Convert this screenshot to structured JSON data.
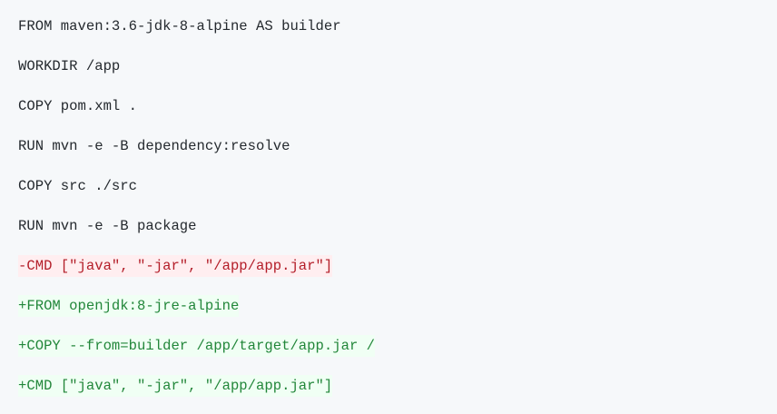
{
  "code": {
    "language": "diff",
    "lines": [
      {
        "type": "context",
        "text": "FROM maven:3.6-jdk-8-alpine AS builder"
      },
      {
        "type": "context",
        "text": "WORKDIR /app"
      },
      {
        "type": "context",
        "text": "COPY pom.xml ."
      },
      {
        "type": "context",
        "text": "RUN mvn -e -B dependency:resolve"
      },
      {
        "type": "context",
        "text": "COPY src ./src"
      },
      {
        "type": "context",
        "text": "RUN mvn -e -B package"
      },
      {
        "type": "removed",
        "text": "-CMD [\"java\", \"-jar\", \"/app/app.jar\"]"
      },
      {
        "type": "added",
        "text": "+FROM openjdk:8-jre-alpine"
      },
      {
        "type": "added",
        "text": "+COPY --from=builder /app/target/app.jar /"
      },
      {
        "type": "added",
        "text": "+CMD [\"java\", \"-jar\", \"/app/app.jar\"]"
      }
    ]
  },
  "colors": {
    "background": "#f6f8fa",
    "context_text": "#24292e",
    "removed_text": "#b31d28",
    "removed_bg": "#ffeef0",
    "added_text": "#22863a",
    "added_bg": "#f0fff4"
  }
}
